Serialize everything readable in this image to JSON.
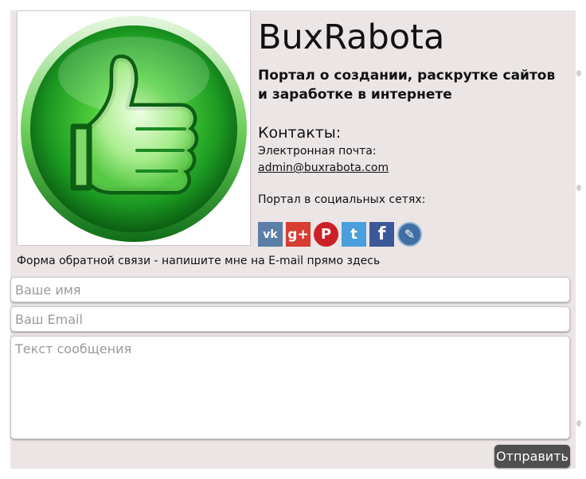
{
  "site": {
    "title": "BuxRabota",
    "tagline": "Портал о создании, раскрутке сайтов и заработке в интернете"
  },
  "contacts": {
    "heading": "Контакты:",
    "email_label": "Электронная почта:",
    "email": "admin@buxrabota.com",
    "social_label": "Портал в социальных сетях:"
  },
  "social": [
    {
      "icon": "vk-icon",
      "glyph": "vk",
      "color": "#5b7fa6"
    },
    {
      "icon": "google-plus-icon",
      "glyph": "g+",
      "color": "#d73d32"
    },
    {
      "icon": "pinterest-icon",
      "glyph": "P",
      "color": "#cb2027"
    },
    {
      "icon": "twitter-icon",
      "glyph": "t",
      "color": "#4a9fdc"
    },
    {
      "icon": "facebook-icon",
      "glyph": "f",
      "color": "#3b5998"
    },
    {
      "icon": "livejournal-icon",
      "glyph": "✎",
      "color": "#3f6fa3"
    }
  ],
  "form": {
    "caption": "Форма обратной связи - напишите мне на E-mail прямо здесь",
    "name_placeholder": "Ваше имя",
    "email_placeholder": "Ваш Email",
    "message_placeholder": "Текст сообщения",
    "submit_label": "Отправить"
  },
  "colors": {
    "card_bg": "#ebe5e5",
    "button_bg": "#4f4f4f",
    "logo_green": "#2fb832"
  }
}
